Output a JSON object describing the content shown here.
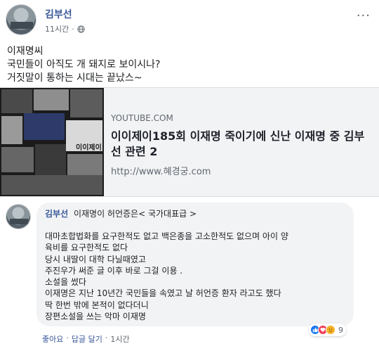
{
  "post": {
    "author": "김부선",
    "time": "11시간",
    "separator": "·",
    "more": "···",
    "privacy_icon": "globe-icon",
    "text_lines": [
      "이재명씨",
      "국민들이 아직도 개 돼지로 보이시나?",
      "거짓말이 통하는 시대는 끝났스~"
    ]
  },
  "link_preview": {
    "source": "YOUTUBE.COM",
    "title": "이이제이185회 이재명 죽이기에 신난 이재명 중 김부선 관련 2",
    "url": "http://www.혜경궁.com",
    "thumbnail_caption": "이이제이"
  },
  "comment": {
    "author": "김부선",
    "headline": "이재명이 허언증은< 국가대표급 >",
    "lines": [
      "대마초합법화를 요구한적도 없고 백은종을 고소한적도 없으며 아이 양",
      "육비를 요구한적도 없다",
      "당시 내딸이 대학 다닐때였고",
      "주진우가 써준 글 이후 바로 그걸 이용 .",
      "소설을 썼다",
      "이재명은 지난 10년간 국민들을 속였고 날 허언증 환자 라고도 했다",
      "딱 한번 밖에 본적이 없다더니",
      "장편소설을 쓰는 악마 이재명"
    ],
    "reaction_count": "9",
    "reactions": [
      "like",
      "love",
      "sad"
    ],
    "actions": {
      "like": "좋아요",
      "reply": "답글 달기",
      "dot": "·",
      "time": "1시간"
    }
  }
}
